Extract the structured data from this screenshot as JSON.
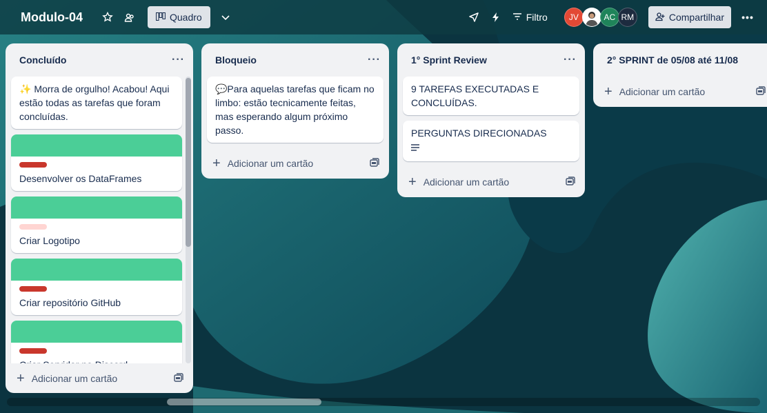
{
  "header": {
    "board_title": "Modulo-04",
    "view_label": "Quadro",
    "filter_label": "Filtro",
    "share_label": "Compartilhar",
    "avatars": [
      {
        "initials": "JV",
        "color": "#e34935"
      },
      {
        "initials": "",
        "color": "#ffffff"
      },
      {
        "initials": "AC",
        "color": "#1f845a"
      },
      {
        "initials": "RM",
        "color": "#1d2b3f"
      }
    ]
  },
  "lists": [
    {
      "title": "Concluído",
      "cards": [
        {
          "text": "✨ Morra de orgulho! Acabou! Aqui estão todas as tarefas que foram concluídas."
        },
        {
          "text": "Desenvolver os DataFrames",
          "label_color": "#c9372c",
          "cover_color": "#4bce97"
        },
        {
          "text": "Criar Logotipo",
          "label_color": "#ffd5d2",
          "cover_color": "#4bce97"
        },
        {
          "text": "Criar repositório GitHub",
          "label_color": "#c9372c",
          "cover_color": "#4bce97"
        },
        {
          "text": "Criar Servidor no Discord",
          "label_color": "#c9372c",
          "cover_color": "#4bce97"
        }
      ],
      "add_label": "Adicionar um cartão"
    },
    {
      "title": "Bloqueio",
      "cards": [
        {
          "text": "💬Para aquelas tarefas que ficam no limbo: estão tecnicamente feitas, mas esperando algum próximo passo."
        }
      ],
      "add_label": "Adicionar um cartão"
    },
    {
      "title": "1° Sprint Review",
      "cards": [
        {
          "text": "9 TAREFAS EXECUTADAS E CONCLUÍDAS."
        },
        {
          "text": "PERGUNTAS DIRECIONADAS",
          "has_description": true
        }
      ],
      "add_label": "Adicionar um cartão"
    },
    {
      "title": "2° SPRINT de 05/08 até 11/08",
      "cards": [],
      "add_label": "Adicionar um cartão"
    }
  ],
  "icons": {
    "star": "star-icon",
    "workspace": "workspace-visibility-icon",
    "board": "board-view-icon",
    "chevron": "chevron-down-icon",
    "power_ups": "rocket-icon",
    "automation": "lightning-icon",
    "filter": "filter-icon",
    "share": "add-person-icon",
    "more": "more-icon",
    "template": "card-template-icon"
  }
}
